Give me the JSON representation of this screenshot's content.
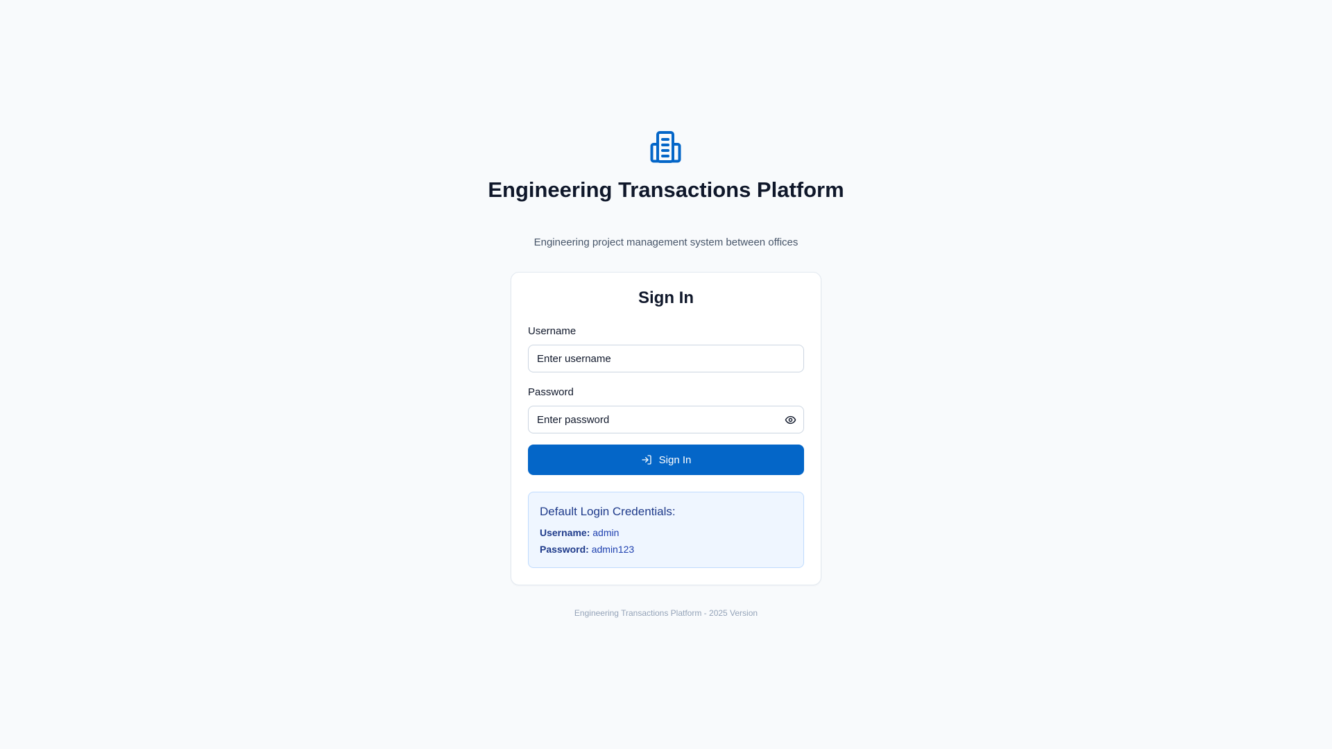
{
  "brand": {
    "logo_icon": "building-icon",
    "accent_color": "#0466c8",
    "title": "Engineering Transactions Platform",
    "subtitle": "Engineering project management system between offices"
  },
  "login_form": {
    "heading": "Sign In",
    "username": {
      "label": "Username",
      "placeholder": "Enter username",
      "value": ""
    },
    "password": {
      "label": "Password",
      "placeholder": "Enter password",
      "value": "",
      "toggle_icon": "eye-icon"
    },
    "submit": {
      "label": "Sign In",
      "icon": "log-in-icon"
    }
  },
  "credentials_hint": {
    "title": "Default Login Credentials:",
    "username_label": "Username:",
    "username_value": "admin",
    "password_label": "Password:",
    "password_value": "admin123"
  },
  "footer": {
    "text": "Engineering Transactions Platform - 2025 Version"
  }
}
